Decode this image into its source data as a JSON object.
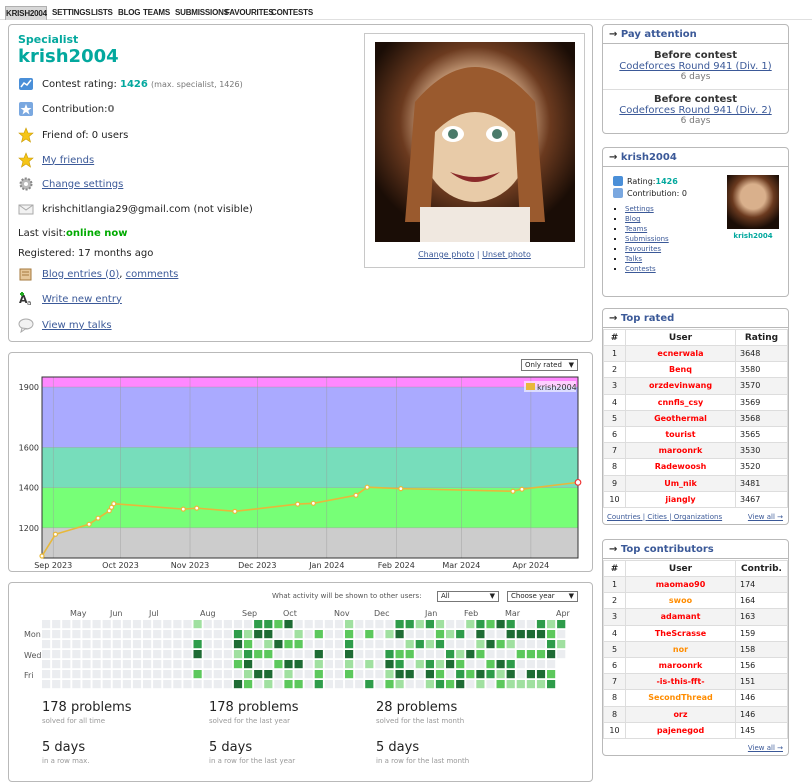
{
  "nav": [
    "KRISH2004",
    "SETTINGS",
    "LISTS",
    "BLOG",
    "TEAMS",
    "SUBMISSIONS",
    "FAVOURITES",
    "CONTESTS"
  ],
  "profile": {
    "rank": "Specialist",
    "handle": "krish2004",
    "rating_label": "Contest rating: ",
    "rating": "1426",
    "rating_max": "(max. specialist, 1426)",
    "contribution_label": "Contribution: ",
    "contribution": "0",
    "friend_of": "Friend of: 0 users",
    "my_friends": "My friends",
    "change_settings": "Change settings",
    "email": "krishchitlangia29@gmail.com (not visible)",
    "last_visit_label": "Last visit: ",
    "last_visit": "online now",
    "registered": "Registered: 17 months ago",
    "blog_entries": "Blog entries (0)",
    "comments": "comments",
    "write_entry": "Write new entry",
    "view_talks": "View my talks",
    "change_photo": "Change photo",
    "unset_photo": "Unset photo"
  },
  "chart_data": {
    "type": "line",
    "filter": "Only rated",
    "legend": "krish2004",
    "legend_position": "top-right",
    "x_ticks": [
      "Sep 2023",
      "Oct 2023",
      "Nov 2023",
      "Dec 2023",
      "Jan 2024",
      "Feb 2024",
      "Mar 2024",
      "Apr 2024"
    ],
    "y_ticks": [
      1200,
      1400,
      1600,
      1900
    ],
    "ylim": [
      1050,
      1950
    ],
    "bands": [
      {
        "from": 1050,
        "to": 1200,
        "color": "#cccccc"
      },
      {
        "from": 1200,
        "to": 1400,
        "color": "#77ff77"
      },
      {
        "from": 1400,
        "to": 1600,
        "color": "#77ddbb"
      },
      {
        "from": 1600,
        "to": 1900,
        "color": "#aaaaff"
      },
      {
        "from": 1900,
        "to": 1950,
        "color": "#ff88ff"
      }
    ],
    "series": [
      {
        "name": "krish2004",
        "color": "#e8b83a",
        "points": [
          {
            "x": "2023-08-27",
            "y": 1060
          },
          {
            "x": "2023-09-02",
            "y": 1168
          },
          {
            "x": "2023-09-17",
            "y": 1218
          },
          {
            "x": "2023-09-21",
            "y": 1248
          },
          {
            "x": "2023-09-26",
            "y": 1285
          },
          {
            "x": "2023-09-27",
            "y": 1302
          },
          {
            "x": "2023-09-28",
            "y": 1320
          },
          {
            "x": "2023-10-29",
            "y": 1293
          },
          {
            "x": "2023-11-04",
            "y": 1298
          },
          {
            "x": "2023-11-21",
            "y": 1282
          },
          {
            "x": "2023-12-19",
            "y": 1318
          },
          {
            "x": "2023-12-26",
            "y": 1322
          },
          {
            "x": "2024-01-14",
            "y": 1362
          },
          {
            "x": "2024-01-19",
            "y": 1402
          },
          {
            "x": "2024-02-03",
            "y": 1395
          },
          {
            "x": "2024-03-24",
            "y": 1382
          },
          {
            "x": "2024-03-28",
            "y": 1392
          },
          {
            "x": "2024-04-22",
            "y": 1426
          }
        ]
      }
    ],
    "x_range": [
      "2023-08-27",
      "2024-04-22"
    ],
    "grid": true
  },
  "activity": {
    "visibility_label": "What activity will be shown to other users:",
    "visibility": "All",
    "year": "Choose year",
    "months": [
      "May",
      "Jun",
      "Jul",
      "Aug",
      "Sep",
      "Oct",
      "Nov",
      "Dec",
      "Jan",
      "Feb",
      "Mar",
      "Apr"
    ],
    "days": [
      "Mon",
      "Wed",
      "Fri"
    ],
    "stats": [
      {
        "big": "178 problems",
        "small": "solved for all time"
      },
      {
        "big": "178 problems",
        "small": "solved for the last year"
      },
      {
        "big": "28 problems",
        "small": "solved for the last month"
      },
      {
        "big": "5 days",
        "small": "in a row max."
      },
      {
        "big": "5 days",
        "small": "in a row for the last year"
      },
      {
        "big": "5 days",
        "small": "in a row for the last month"
      }
    ],
    "colors": [
      "#ebedf0",
      "#a0e0a0",
      "#5cc85c",
      "#2e9c4a",
      "#1e6b34"
    ]
  },
  "pay_attention": {
    "title": "Pay attention",
    "contests": [
      {
        "label": "Before contest",
        "name": "Codeforces Round 941 (Div. 1)",
        "days": "6 days"
      },
      {
        "label": "Before contest",
        "name": "Codeforces Round 941 (Div. 2)",
        "days": "6 days"
      }
    ]
  },
  "user_box": {
    "title": "krish2004",
    "rating_label": "Rating: ",
    "rating": "1426",
    "contribution": "Contribution: 0",
    "links": [
      "Settings",
      "Blog",
      "Teams",
      "Submissions",
      "Favourites",
      "Talks",
      "Contests"
    ],
    "handle": "krish2004"
  },
  "top_rated": {
    "title": "Top rated",
    "headers": [
      "#",
      "User",
      "Rating"
    ],
    "rows": [
      [
        "1",
        "ecnerwala",
        "3648"
      ],
      [
        "2",
        "Benq",
        "3580"
      ],
      [
        "3",
        "orzdevinwang",
        "3570"
      ],
      [
        "4",
        "cnnfls_csy",
        "3569"
      ],
      [
        "5",
        "Geothermal",
        "3568"
      ],
      [
        "6",
        "tourist",
        "3565"
      ],
      [
        "7",
        "maroonrk",
        "3530"
      ],
      [
        "8",
        "Radewoosh",
        "3520"
      ],
      [
        "9",
        "Um_nik",
        "3481"
      ],
      [
        "10",
        "jiangly",
        "3467"
      ]
    ],
    "foot": [
      "Countries",
      "Cities",
      "Organizations"
    ],
    "view_all": "View all →"
  },
  "top_contributors": {
    "title": "Top contributors",
    "headers": [
      "#",
      "User",
      "Contrib."
    ],
    "rows": [
      [
        "1",
        "maomao90",
        "174"
      ],
      [
        "2",
        "swoo",
        "164"
      ],
      [
        "3",
        "adamant",
        "163"
      ],
      [
        "4",
        "TheScrasse",
        "159"
      ],
      [
        "5",
        "nor",
        "158"
      ],
      [
        "6",
        "maroonrk",
        "156"
      ],
      [
        "7",
        "-is-this-fft-",
        "151"
      ],
      [
        "8",
        "SecondThread",
        "146"
      ],
      [
        "8",
        "orz",
        "146"
      ],
      [
        "10",
        "pajenegod",
        "145"
      ]
    ],
    "view_all": "View all →"
  },
  "name_colors": {
    "red": "#ff0000",
    "legend": "#000000",
    "orange": "#ff8c00"
  }
}
